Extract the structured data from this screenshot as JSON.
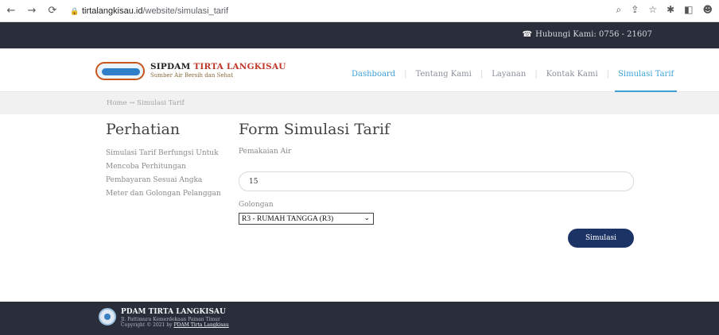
{
  "browser": {
    "url_host": "tirtalangkisau.id",
    "url_path": "/website/simulasi_tarif"
  },
  "topbar": {
    "contact_label": "Hubungi Kami: 0756 - 21607"
  },
  "brand": {
    "name_main": "SIPDAM ",
    "name_accent": "TIRTA LANGKISAU",
    "tagline": "Sumber Air Bersih dan Sehat"
  },
  "menu": {
    "items": [
      {
        "label": "Dashboard"
      },
      {
        "label": "Tentang Kami"
      },
      {
        "label": "Layanan"
      },
      {
        "label": "Kontak Kami"
      },
      {
        "label": "Simulasi Tarif"
      }
    ]
  },
  "breadcrumb": "Home → Simulasi Tarif",
  "notice": {
    "title": "Perhatian",
    "text": "Simulasi Tarif Berfungsi Untuk Mencoba Perhitungan Pembayaran Sesuai Angka Meter dan Golongan Pelanggan"
  },
  "form": {
    "title": "Form Simulasi Tarif",
    "usage_label": "Pemakaian Air",
    "usage_value": "15",
    "group_label": "Golongan",
    "group_selected": "R3 - RUMAH TANGGA (R3)",
    "submit_label": "Simulasi"
  },
  "footer": {
    "org_name": "PDAM TIRTA LANGKISAU",
    "address": "Jl. Pattimura Kemerdekaan Painan Timur",
    "copyright_prefix": "Copyright © 2021 by ",
    "copyright_link": "PDAM Tirta Langkisau"
  },
  "colors": {
    "topbar_bg": "#2a2e3a",
    "accent": "#3aa0d6",
    "button_bg": "#1c3366"
  }
}
